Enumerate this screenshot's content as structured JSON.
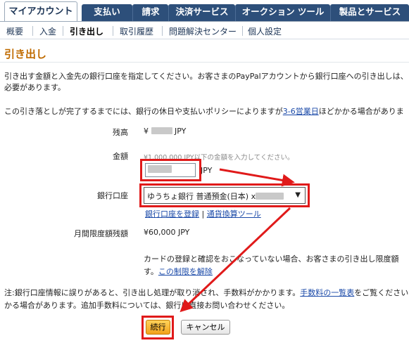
{
  "tabs": [
    {
      "label": "マイアカウント",
      "active": true
    },
    {
      "label": "支払い"
    },
    {
      "label": "請求"
    },
    {
      "label": "決済サービス"
    },
    {
      "label": "オークション ツール"
    },
    {
      "label": "製品とサービス"
    }
  ],
  "subnav": [
    "概要",
    "入金",
    "引き出し",
    "取引履歴",
    "問題解決センター",
    "個人設定"
  ],
  "page_title": "引き出し",
  "intro_line1": "引き出す金額と入金先の銀行口座を指定してください。お客さまのPayPalアカウントから銀行口座への引き出しは、",
  "intro_line2": "必要があります。",
  "notice_pre": "この引き落としが完了するまでには、銀行の休日や支払いポリシーによりますが",
  "notice_link": "3-6営業日",
  "notice_post": "ほどかかる場合がありま",
  "form": {
    "balance_label": "残高",
    "balance_prefix": "¥",
    "balance_suffix": "JPY",
    "amount_label": "金額",
    "amount_hint": "¥1,000,000 JPY以下の金額を入力してください。",
    "amount_currency": "JPY",
    "bank_label": "銀行口座",
    "bank_selected": "ゆうちょ銀行 普通預金(日本) x",
    "bank_arrow": "▼",
    "register_link": "銀行口座を登録",
    "pipe": "|",
    "currency_link": "通貨換算ツール",
    "limit_label": "月間限度額残額",
    "limit_value": "¥60,000 JPY",
    "limit_note1": "カードの登録と確認をおこなっていない場合、お客さまの引き出し限度額",
    "limit_note2_pre": "す。",
    "limit_note2_link": "この制限を解除"
  },
  "footnote_pre": "注:銀行口座情報に誤りがあると、引き出し処理が取り消され、手数料がかかります。",
  "footnote_link": "手数料の一覧表",
  "footnote_post": "をご覧ください",
  "footnote_line2": "かる場合があります。追加手数料については、銀行に直接お問い合わせください。",
  "buttons": {
    "continue": "続行",
    "cancel": "キャンセル"
  },
  "colors": {
    "tab_bg": "#2d4f7a",
    "title": "#c06b00",
    "annotation": "#e01a1a",
    "link": "#1a49a8"
  }
}
